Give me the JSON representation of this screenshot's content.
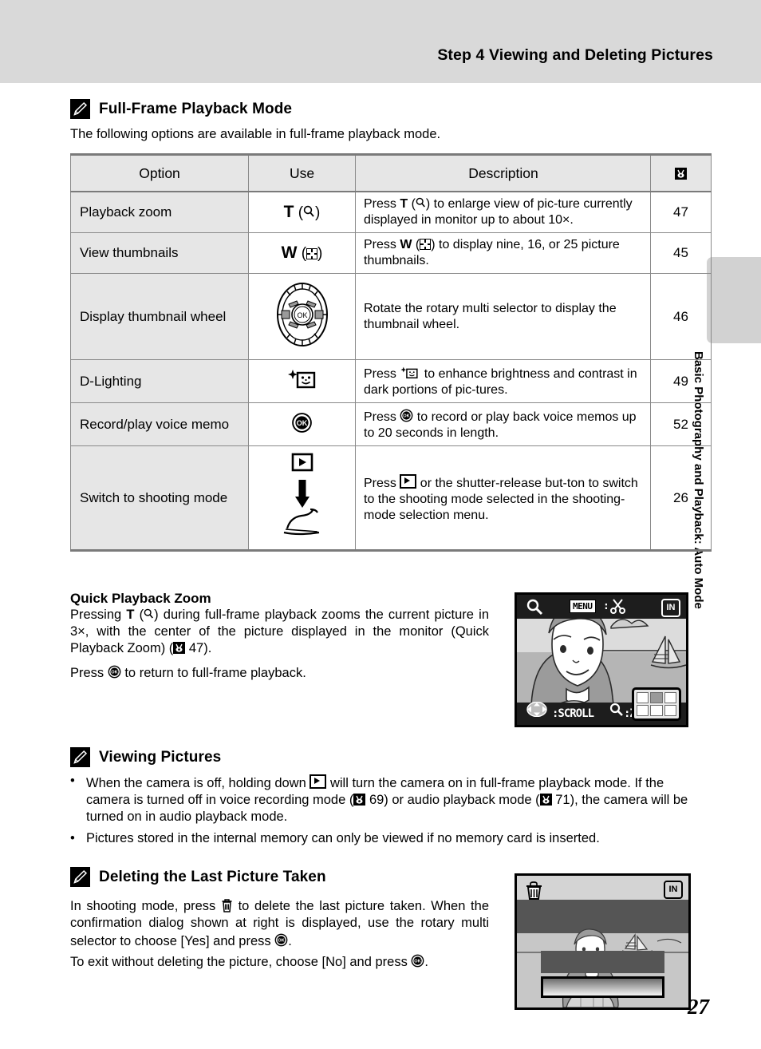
{
  "page": {
    "number": "27",
    "running_header": "Step 4 Viewing and Deleting Pictures",
    "side_tab_label": "Basic Photography and Playback: Auto Mode"
  },
  "section1": {
    "icon": "pencil-note-icon",
    "heading": "Full-Frame Playback Mode",
    "intro": "The following options are available in full-frame playback mode.",
    "table": {
      "headers": {
        "option": "Option",
        "use": "Use",
        "description": "Description",
        "page": "page-reference-icon"
      },
      "rows": [
        {
          "option": "Playback zoom",
          "use_main": "T",
          "use_paren_icon": "magnifier-icon",
          "description": "Press T (magnifier-icon) to enlarge view of picture currently displayed in monitor up to about 10×.",
          "desc_pre": "Press ",
          "desc_key": "T",
          "desc_mid": ") to enlarge view of pic-ture currently displayed in monitor up to about 10×.",
          "page": "47"
        },
        {
          "option": "View thumbnails",
          "use_main": "W",
          "use_paren_icon": "thumbnail-grid-icon",
          "description": "Press W (thumbnail-grid-icon) to display nine, 16, or 25 picture thumbnails.",
          "desc_pre": "Press ",
          "desc_key": "W",
          "desc_mid": ") to display nine, 16, or 25 picture thumbnails.",
          "page": "45"
        },
        {
          "option": "Display thumbnail wheel",
          "use_main": "",
          "use_paren_icon": "rotary-multi-selector-icon",
          "description": "Rotate the rotary multi selector to display the thumbnail wheel.",
          "page": "46"
        },
        {
          "option": "D-Lighting",
          "use_main": "",
          "use_paren_icon": "d-lighting-icon",
          "description": "Press (d-lighting-icon) to enhance brightness and contrast in dark portions of pictures.",
          "desc_pre": "Press ",
          "desc_mid": " to enhance brightness and contrast in dark portions of pic-tures.",
          "page": "49"
        },
        {
          "option": "Record/play voice memo",
          "use_main": "",
          "use_paren_icon": "ok-button-icon",
          "description": "Press (ok-button-icon) to record or play back voice memos up to 20 seconds in length.",
          "desc_pre": "Press ",
          "desc_mid": " to record or play back voice memos up to 20 seconds in length.",
          "page": "52"
        },
        {
          "option": "Switch to shooting mode",
          "use_main": "",
          "use_paren_icon": "playback-button-arrow-shutter-icon",
          "description": "Press (playback-button-icon) or the shutter-release button to switch to the shooting mode selected in the shooting-mode selection menu.",
          "desc_pre": "Press ",
          "desc_mid": " or the shutter-release but-ton to switch to the shooting mode selected in the shooting-mode selection menu.",
          "page": "26"
        }
      ]
    }
  },
  "quick_zoom": {
    "heading": "Quick Playback Zoom",
    "line1_pre": "Pressing ",
    "line1_key": "T",
    "line1_post": ") during full-frame playback zooms the current picture in 3×, with the center of the picture displayed in the monitor (Quick Playback Zoom) (",
    "line1_ref": " 47).",
    "line2_pre": "Press ",
    "line2_post": " to return to full-frame playback.",
    "monitor": {
      "menu_label": "MENU",
      "menu_sep": ":",
      "in_badge": "IN",
      "bottom_left": ":SCROLL",
      "bottom_right": ":ZOOM",
      "magnifier": "magnifier-icon",
      "scissors": "scissors-icon"
    }
  },
  "section2": {
    "icon": "pencil-note-icon",
    "heading": "Viewing Pictures",
    "bullets": [
      {
        "pre": "When the camera is off, holding down ",
        "mid": " will turn the camera on in full-frame playback mode. If the camera is turned off in voice recording mode (",
        "ref1": " 69) or audio playback mode (",
        "ref2": " 71), the camera will be turned on in audio playback mode."
      },
      {
        "text": "Pictures stored in the internal memory can only be viewed if no memory card is inserted."
      }
    ]
  },
  "section3": {
    "icon": "pencil-note-icon",
    "heading": "Deleting the Last Picture Taken",
    "para1_pre": "In shooting mode, press ",
    "para1_mid": " to delete the last picture taken. When the confirmation dialog shown at right is displayed, use the rotary multi selector to choose [Yes] and press ",
    "para1_post": ".",
    "para2_pre": "To exit without deleting the picture, choose [No] and press ",
    "para2_post": ".",
    "monitor": {
      "trash": "trash-icon",
      "in_badge": "IN"
    }
  },
  "colors": {
    "header_band": "#d9d9d9",
    "table_header_fill": "#e6e6e6",
    "table_option_fill": "#e6e6e6",
    "rule": "#7a7a7a",
    "side_tab": "#d2d2d2"
  }
}
